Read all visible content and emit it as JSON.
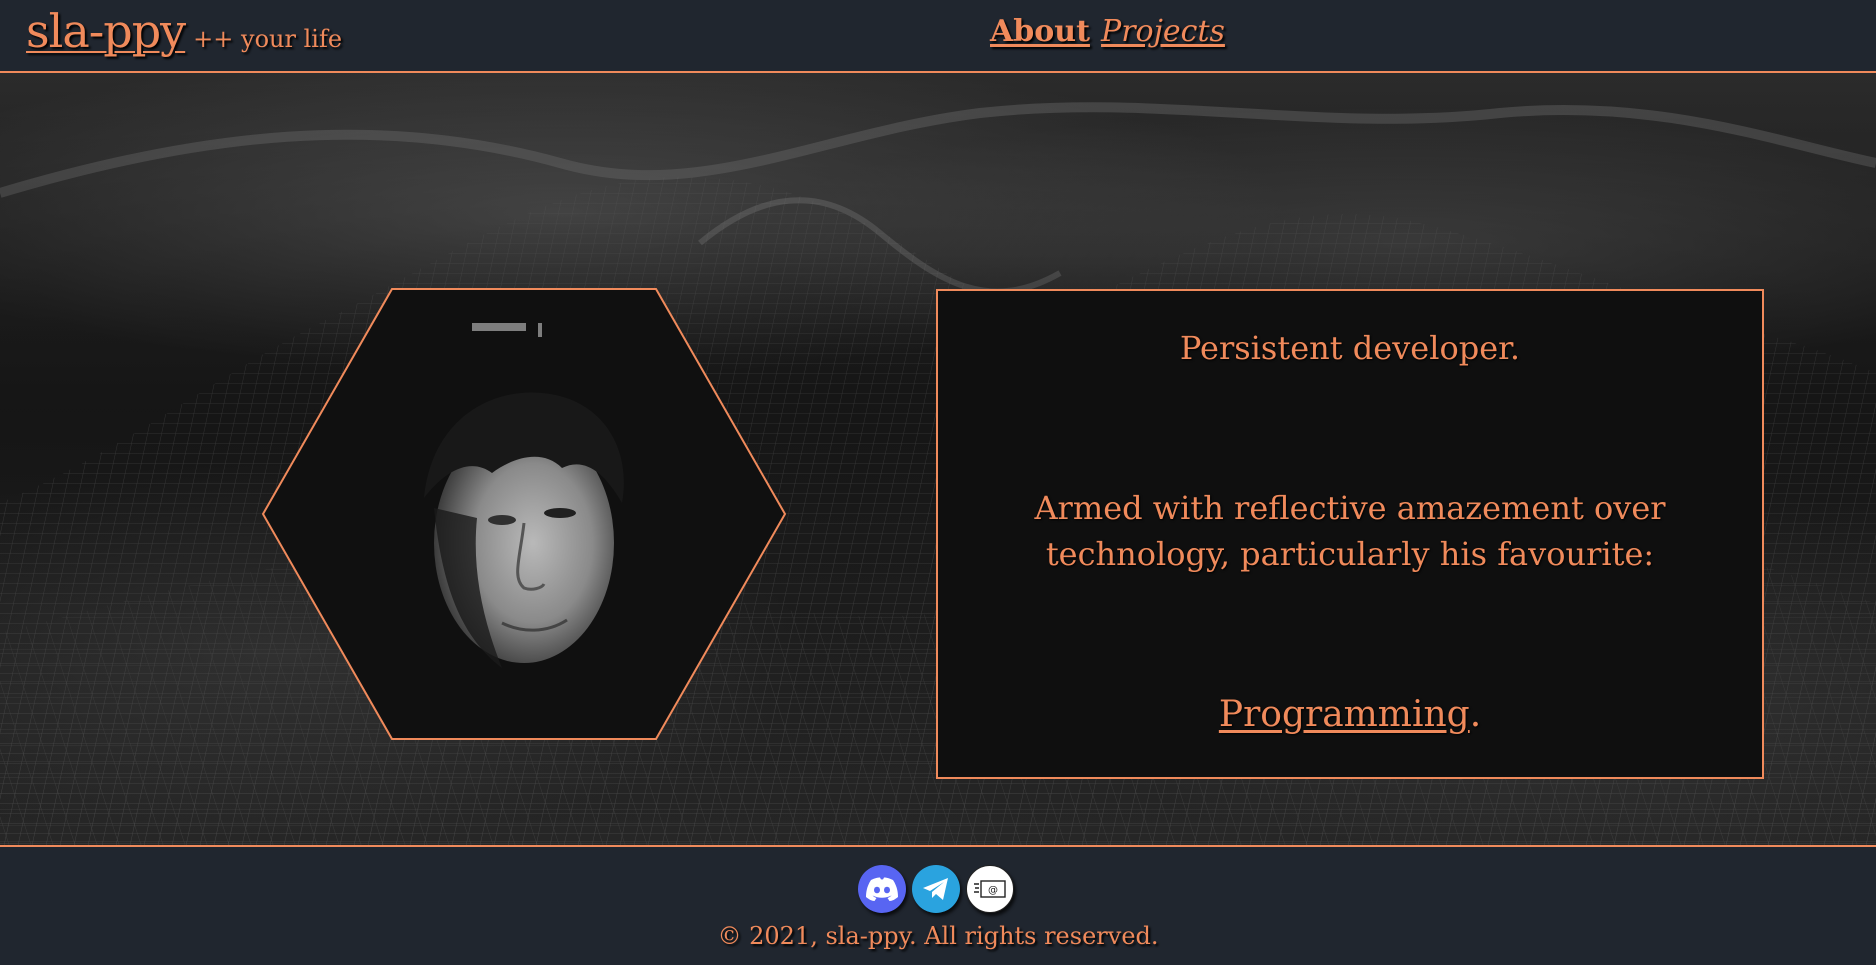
{
  "header": {
    "brand_name": "sla-ppy",
    "brand_tagline": "++ your life",
    "nav": {
      "about_label": "About",
      "projects_label": "Projects"
    }
  },
  "hero": {
    "portrait_icon": "person-portrait",
    "info": {
      "line1": "Persistent developer.",
      "line2": "Armed with reflective amazement over technology, particularly his favourite:",
      "line3_link": "Programming",
      "line3_suffix": "."
    }
  },
  "footer": {
    "socials": [
      {
        "icon": "discord-icon",
        "color": "#5865f2"
      },
      {
        "icon": "telegram-icon",
        "color": "#2aa3df"
      },
      {
        "icon": "email-icon",
        "color": "#ffffff"
      }
    ],
    "copyright": "© 2021, sla-ppy. All rights reserved."
  },
  "colors": {
    "accent": "#f08a5b",
    "bar_background": "#20262f",
    "box_background": "#0f0f0f"
  }
}
